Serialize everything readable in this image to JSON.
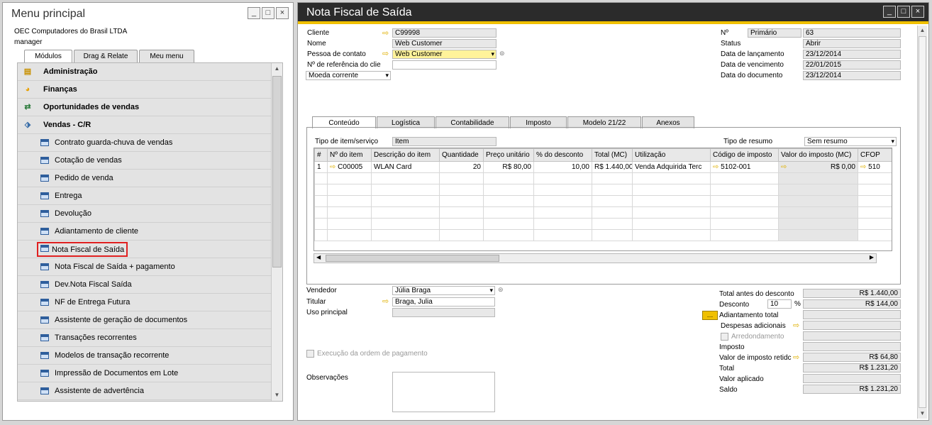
{
  "left": {
    "title": "Menu principal",
    "company": "OEC Computadores do Brasil LTDA",
    "user": "manager",
    "tabs": [
      "Módulos",
      "Drag & Relate",
      "Meu menu"
    ],
    "modules": [
      "Administração",
      "Finanças",
      "Oportunidades de vendas",
      "Vendas - C/R"
    ],
    "items": [
      "Contrato guarda-chuva de vendas",
      "Cotação de vendas",
      "Pedido de venda",
      "Entrega",
      "Devolução",
      "Adiantamento de cliente",
      "Nota Fiscal de Saída",
      "Nota Fiscal de Saída + pagamento",
      "Dev.Nota Fiscal Saída",
      "NF de Entrega Futura",
      "Assistente de geração de documentos",
      "Transações recorrentes",
      "Modelos de transação recorrente",
      "Impressão de Documentos em Lote",
      "Assistente de advertência"
    ]
  },
  "doc": {
    "title": "Nota Fiscal de Saída",
    "header": {
      "cliente_label": "Cliente",
      "cliente": "C99998",
      "nome_label": "Nome",
      "nome": "Web Customer",
      "contato_label": "Pessoa de contato",
      "contato": "Web Customer",
      "ref_label": "Nº de referência do clie",
      "ref": "",
      "moeda": "Moeda corrente",
      "no_label": "Nº",
      "serie": "Primário",
      "numero": "63",
      "status_label": "Status",
      "status": "Abrir",
      "lanc_label": "Data de lançamento",
      "lanc": "23/12/2014",
      "venc_label": "Data de vencimento",
      "venc": "22/01/2015",
      "docdate_label": "Data do documento",
      "docdate": "23/12/2014"
    },
    "tabs": [
      "Conteúdo",
      "Logística",
      "Contabilidade",
      "Imposto",
      "Modelo 21/22",
      "Anexos"
    ],
    "tipo_item_label": "Tipo de item/serviço",
    "tipo_item": "Item",
    "tipo_resumo_label": "Tipo de resumo",
    "tipo_resumo": "Sem resumo",
    "columns": [
      "#",
      "Nº do item",
      "Descrição do item",
      "Quantidade",
      "Preço unitário",
      "% do desconto",
      "Total (MC)",
      "Utilização",
      "Código de imposto",
      "Valor do imposto (MC)",
      "CFOP"
    ],
    "row": {
      "n": "1",
      "item": "C00005",
      "desc": "WLAN Card",
      "qty": "20",
      "price": "R$ 80,00",
      "disc": "10,00",
      "total": "R$ 1.440,00",
      "util": "Venda Adquirida Terc",
      "tax": "5102-001",
      "taxval": "R$ 0,00",
      "cfop": "510"
    },
    "footer": {
      "vendedor_label": "Vendedor",
      "vendedor": "Júlia Braga",
      "titular_label": "Titular",
      "titular": "Braga, Julia",
      "uso_label": "Uso principal",
      "execucao": "Execução da ordem de pagamento",
      "obs_label": "Observações",
      "tad_label": "Total antes do desconto",
      "tad": "R$ 1.440,00",
      "desc_label": "Desconto",
      "desc_pct": "10",
      "pct": "%",
      "desc_val": "R$ 144,00",
      "adiant_label": "Adiantamento total",
      "desp_label": "Despesas adicionais",
      "arred_label": "Arredondamento",
      "imposto_label": "Imposto",
      "retido_label": "Valor de imposto retidc",
      "retido": "R$ 64,80",
      "total_label": "Total",
      "total": "R$ 1.231,20",
      "aplicado_label": "Valor aplicado",
      "saldo_label": "Saldo",
      "saldo": "R$ 1.231,20"
    }
  }
}
